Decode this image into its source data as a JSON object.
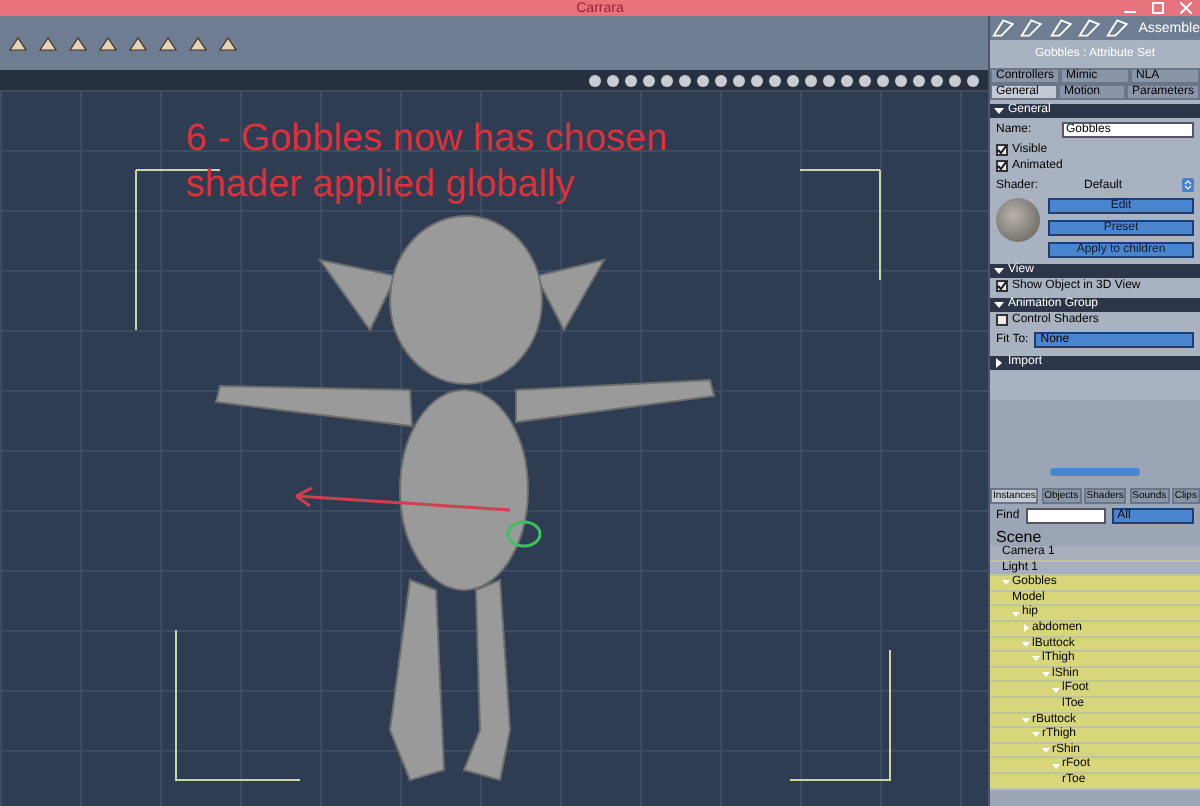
{
  "window": {
    "title": "Carrara"
  },
  "toolbar": {
    "room": "Assemble"
  },
  "viewport": {
    "annotation": "6 - Gobbles now has chosen shader applied globally"
  },
  "attributes": {
    "title": "Gobbles : Attribute Set",
    "tabs_top": [
      {
        "label": "Controllers",
        "selected": false
      },
      {
        "label": "Mimic",
        "selected": false
      },
      {
        "label": "NLA",
        "selected": false
      }
    ],
    "tabs": [
      {
        "label": "General",
        "selected": true
      },
      {
        "label": "Motion",
        "selected": false
      },
      {
        "label": "Parameters",
        "selected": false
      }
    ],
    "general": {
      "header": "General",
      "expanded": true,
      "name_label": "Name:",
      "name": "Gobbles",
      "checkboxes": [
        {
          "label": "Visible",
          "checked": true
        },
        {
          "label": "Animated",
          "checked": true
        }
      ],
      "shader_label": "Shader:",
      "shader": "Default",
      "buttons": [
        "Edit",
        "Preset",
        "Apply to children"
      ]
    },
    "view": {
      "header": "View",
      "expanded": true,
      "checkbox": {
        "label": "Show Object in 3D View",
        "checked": true
      }
    },
    "animation_group": {
      "header": "Animation Group",
      "expanded": true,
      "checkbox": {
        "label": "Control Shaders",
        "checked": false
      },
      "fit_label": "Fit To:",
      "fit": "None"
    },
    "import": {
      "header": "Import",
      "expanded": false
    }
  },
  "browser": {
    "tabs": [
      {
        "label": "Instances",
        "selected": true
      },
      {
        "label": "Objects",
        "selected": false
      },
      {
        "label": "Shaders",
        "selected": false
      },
      {
        "label": "Sounds",
        "selected": false
      },
      {
        "label": "Clips",
        "selected": false
      }
    ],
    "find_label": "Find",
    "filter": "All",
    "tree": {
      "label": "Scene",
      "children": [
        {
          "label": "Camera 1",
          "selected": false
        },
        {
          "label": "Light 1",
          "selected": false
        },
        {
          "label": "Gobbles",
          "selected": true,
          "expanded": true,
          "children": [
            {
              "label": "Model",
              "selected": true
            },
            {
              "label": "hip",
              "selected": true,
              "expanded": true,
              "children": [
                {
                  "label": "abdomen",
                  "selected": true,
                  "expanded": false
                },
                {
                  "label": "lButtock",
                  "selected": true,
                  "expanded": true,
                  "children": [
                    {
                      "label": "lThigh",
                      "selected": true,
                      "expanded": true,
                      "children": [
                        {
                          "label": "lShin",
                          "selected": true,
                          "expanded": true,
                          "children": [
                            {
                              "label": "lFoot",
                              "selected": true,
                              "expanded": true,
                              "children": [
                                {
                                  "label": "lToe",
                                  "selected": true
                                }
                              ]
                            }
                          ]
                        }
                      ]
                    }
                  ]
                },
                {
                  "label": "rButtock",
                  "selected": true,
                  "expanded": true,
                  "children": [
                    {
                      "label": "rThigh",
                      "selected": true,
                      "expanded": true,
                      "children": [
                        {
                          "label": "rShin",
                          "selected": true,
                          "expanded": true,
                          "children": [
                            {
                              "label": "rFoot",
                              "selected": true,
                              "expanded": true,
                              "children": [
                                {
                                  "label": "rToe",
                                  "selected": true
                                }
                              ]
                            }
                          ]
                        }
                      ]
                    }
                  ]
                }
              ]
            }
          ]
        }
      ]
    }
  }
}
